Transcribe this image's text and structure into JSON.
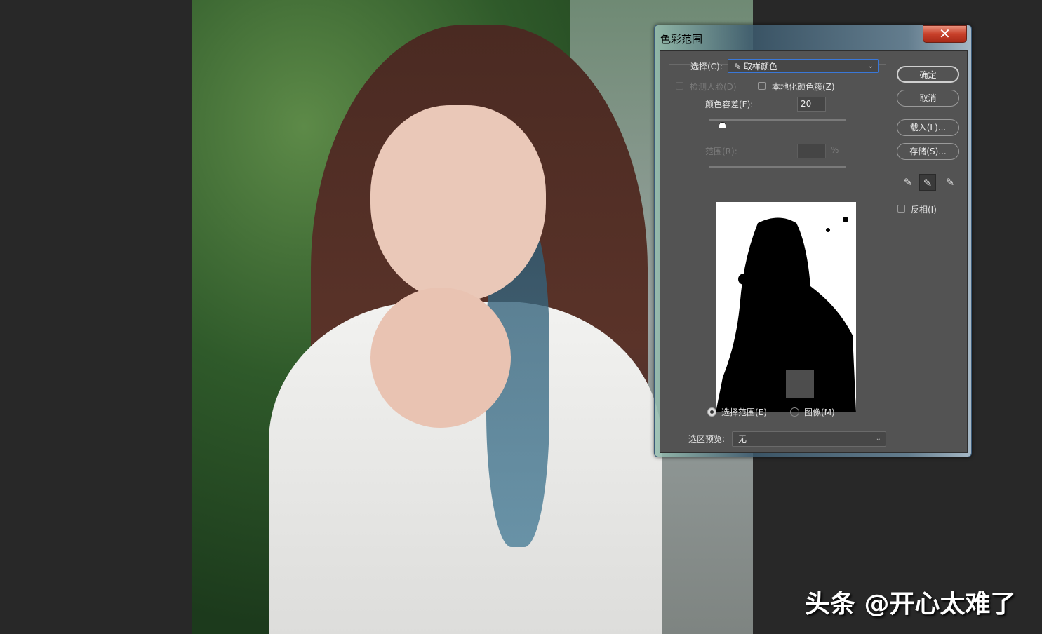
{
  "dialog": {
    "title": "色彩范围",
    "close_label": "✕",
    "select_label": "选择(C):",
    "select_value": "取样颜色",
    "detect_faces_label": "检测人脸(D)",
    "localized_label": "本地化颜色簇(Z)",
    "fuzziness_label": "颜色容差(F):",
    "fuzziness_value": "20",
    "fuzziness_fraction": 0.1,
    "range_label": "范围(R):",
    "range_value": "",
    "range_unit": "%",
    "radio_selection_label": "选择范围(E)",
    "radio_image_label": "图像(M)",
    "preview_label": "选区预览:",
    "preview_value": "无",
    "ok_label": "确定",
    "cancel_label": "取消",
    "load_label": "载入(L)...",
    "save_label": "存储(S)...",
    "invert_label": "反相(I)"
  },
  "watermark": "头条 @开心太难了"
}
